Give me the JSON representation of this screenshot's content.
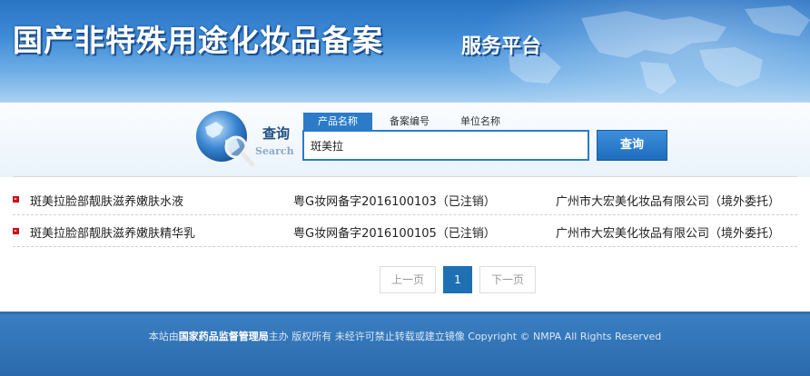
{
  "header": {
    "title": "国产非特殊用途化妆品备案",
    "subtitle": "服务平台"
  },
  "search": {
    "label": "查询",
    "label_en": "Search",
    "tabs": [
      {
        "label": "产品名称",
        "active": true
      },
      {
        "label": "备案编号",
        "active": false
      },
      {
        "label": "单位名称",
        "active": false
      }
    ],
    "value": "斑美拉",
    "button_label": "查询"
  },
  "results": [
    {
      "name": "斑美拉脸部靓肤滋养嫩肤水液",
      "reg": "粤G妆网备字2016100103（已注销）",
      "company": "广州市大宏美化妆品有限公司（境外委托）"
    },
    {
      "name": "斑美拉脸部靓肤滋养嫩肤精华乳",
      "reg": "粤G妆网备字2016100105（已注销）",
      "company": "广州市大宏美化妆品有限公司（境外委托）"
    }
  ],
  "pagination": {
    "prev": "上一页",
    "current": "1",
    "next": "下一页"
  },
  "footer": {
    "prefix": "本站由",
    "org": "国家药品监督管理局",
    "suffix": "主办 版权所有 未经许可禁止转载或建立镜像 Copyright © NMPA All Rights Reserved"
  },
  "colors": {
    "accent": "#2b7bc9",
    "bullet": "#c8101e",
    "footer": "#2a6aac"
  }
}
